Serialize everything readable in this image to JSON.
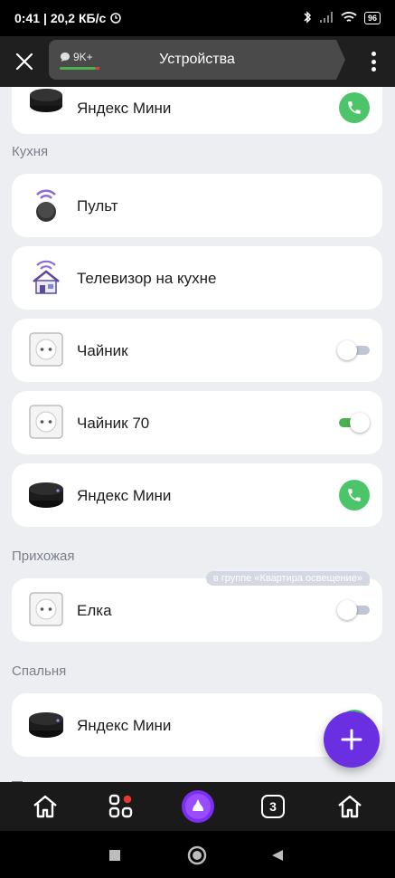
{
  "status_bar": {
    "time": "0:41",
    "speed": "| 20,2 КБ/с",
    "battery": "96"
  },
  "toolbar": {
    "badge": "9K+",
    "title": "Устройства"
  },
  "top_card": {
    "label": "Яндекс Мини"
  },
  "sections": [
    {
      "title": "Кухня"
    },
    {
      "title": "Прихожая"
    },
    {
      "title": "Спальня"
    }
  ],
  "kitchen": [
    {
      "label": "Пульт",
      "icon": "remote-icon"
    },
    {
      "label": "Телевизор на кухне",
      "icon": "tv-house-icon"
    },
    {
      "label": "Чайник",
      "icon": "socket-icon",
      "toggle": "off"
    },
    {
      "label": "Чайник 70",
      "icon": "socket-icon",
      "toggle": "on"
    },
    {
      "label": "Яндекс Мини",
      "icon": "speaker-icon",
      "action": "call"
    }
  ],
  "hallway": [
    {
      "label": "Елка",
      "icon": "socket-icon",
      "toggle": "off",
      "group_tag": "в группе «Квартира освещение»"
    }
  ],
  "bedroom": [
    {
      "label": "Яндекс Мини",
      "icon": "speaker-icon",
      "action": "call"
    }
  ],
  "bottom_nav": {
    "tabs_count": "3"
  },
  "colors": {
    "accent_purple": "#6a2fe0",
    "toggle_on": "#4caf50",
    "call_green": "#4cc46a"
  }
}
